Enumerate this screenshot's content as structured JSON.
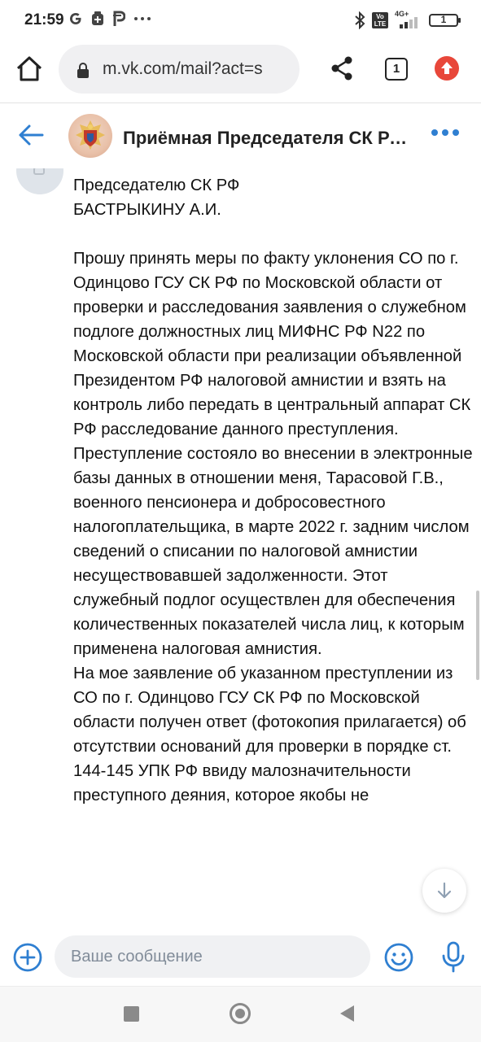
{
  "status_bar": {
    "time": "21:59",
    "network": "4G+",
    "volte": "Vo LTE",
    "battery": "1",
    "icons": [
      "google-icon",
      "app-icon",
      "p-icon",
      "more-icon",
      "bluetooth-icon",
      "volte-icon",
      "signal-icon",
      "battery-icon"
    ]
  },
  "browser": {
    "url": "m.vk.com/mail?act=s",
    "tab_count": "1"
  },
  "chat": {
    "title": "Приёмная Председателя СК России"
  },
  "message": {
    "paragraphs": [
      "Председателю СК РФ",
      "БАСТРЫКИНУ А.И.",
      "",
      "Прошу принять меры по факту уклонения СО по г. Одинцово ГСУ СК РФ по Московской области от проверки и расследования заявления о служебном подлоге должностных лиц МИФНС РФ N22 по Московской области при реализации объявленной Президентом РФ налоговой амнистии и взять на контроль либо передать в центральный аппарат СК РФ расследование данного преступления.",
      "Преступление состояло во внесении в электронные базы данных в отношении меня, Тарасовой Г.В., военного пенсионера и добросовестного налогоплательщика, в марте 2022 г. задним числом сведений о списании по налоговой амнистии несуществовавшей задолженности. Этот служебный подлог осуществлен для обеспечения количественных показателей числа лиц, к которым применена налоговая амнистия.",
      "На мое заявление об указанном преступлении из СО по г. Одинцово ГСУ СК РФ по Московской области получен ответ (фотокопия прилагается) об отсутствии оснований для проверки в порядке ст. 144-145 УПК РФ ввиду малозначительности преступного деяния, которое якобы не"
    ]
  },
  "composer": {
    "placeholder": "Ваше сообщение"
  },
  "colors": {
    "accent": "#2f7fd1",
    "update_badge": "#e8473a",
    "input_bg": "#f0f1f3"
  }
}
